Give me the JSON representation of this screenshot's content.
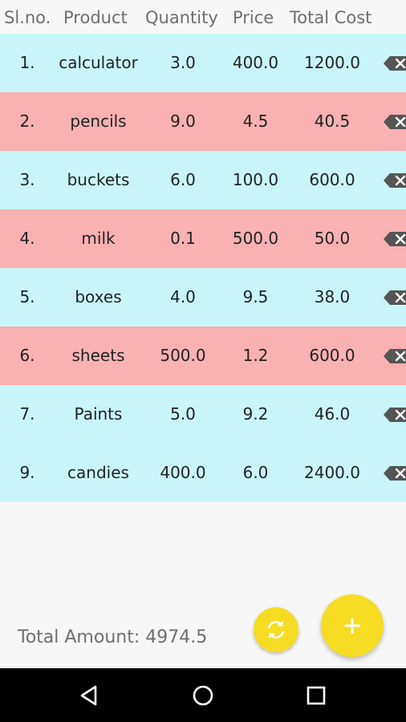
{
  "header": {
    "slno": "Sl.no.",
    "product": "Product",
    "quantity": "Quantity",
    "price": "Price",
    "total_cost": "Total Cost"
  },
  "rows": [
    {
      "no": "1.",
      "product": "calculator",
      "quantity": "3.0",
      "price": "400.0",
      "total": "1200.0",
      "color": "#c8f6f8"
    },
    {
      "no": "2.",
      "product": "pencils",
      "quantity": "9.0",
      "price": "4.5",
      "total": "40.5",
      "color": "#f9b1b3"
    },
    {
      "no": "3.",
      "product": "buckets",
      "quantity": "6.0",
      "price": "100.0",
      "total": "600.0",
      "color": "#c8f6f8"
    },
    {
      "no": "4.",
      "product": "milk",
      "quantity": "0.1",
      "price": "500.0",
      "total": "50.0",
      "color": "#f9b1b3"
    },
    {
      "no": "5.",
      "product": "boxes",
      "quantity": "4.0",
      "price": "9.5",
      "total": "38.0",
      "color": "#c8f6f8"
    },
    {
      "no": "6.",
      "product": "sheets",
      "quantity": "500.0",
      "price": "1.2",
      "total": "600.0",
      "color": "#f9b1b3"
    },
    {
      "no": "7.",
      "product": "Paints",
      "quantity": "5.0",
      "price": "9.2",
      "total": "46.0",
      "color": "#c8f6f8"
    },
    {
      "no": "9.",
      "product": "candies",
      "quantity": "400.0",
      "price": "6.0",
      "total": "2400.0",
      "color": "#c8f6f8"
    }
  ],
  "footer": {
    "total_amount": "Total Amount: 4974.5"
  },
  "icons": {
    "delete": "backspace-icon",
    "refresh": "refresh-icon",
    "add": "plus-icon",
    "nav_back": "triangle-back-icon",
    "nav_home": "circle-home-icon",
    "nav_recents": "square-recents-icon"
  },
  "colors": {
    "row_cyan": "#c8f6f8",
    "row_pink": "#f9b1b3",
    "fab_yellow": "#f7dc24"
  }
}
